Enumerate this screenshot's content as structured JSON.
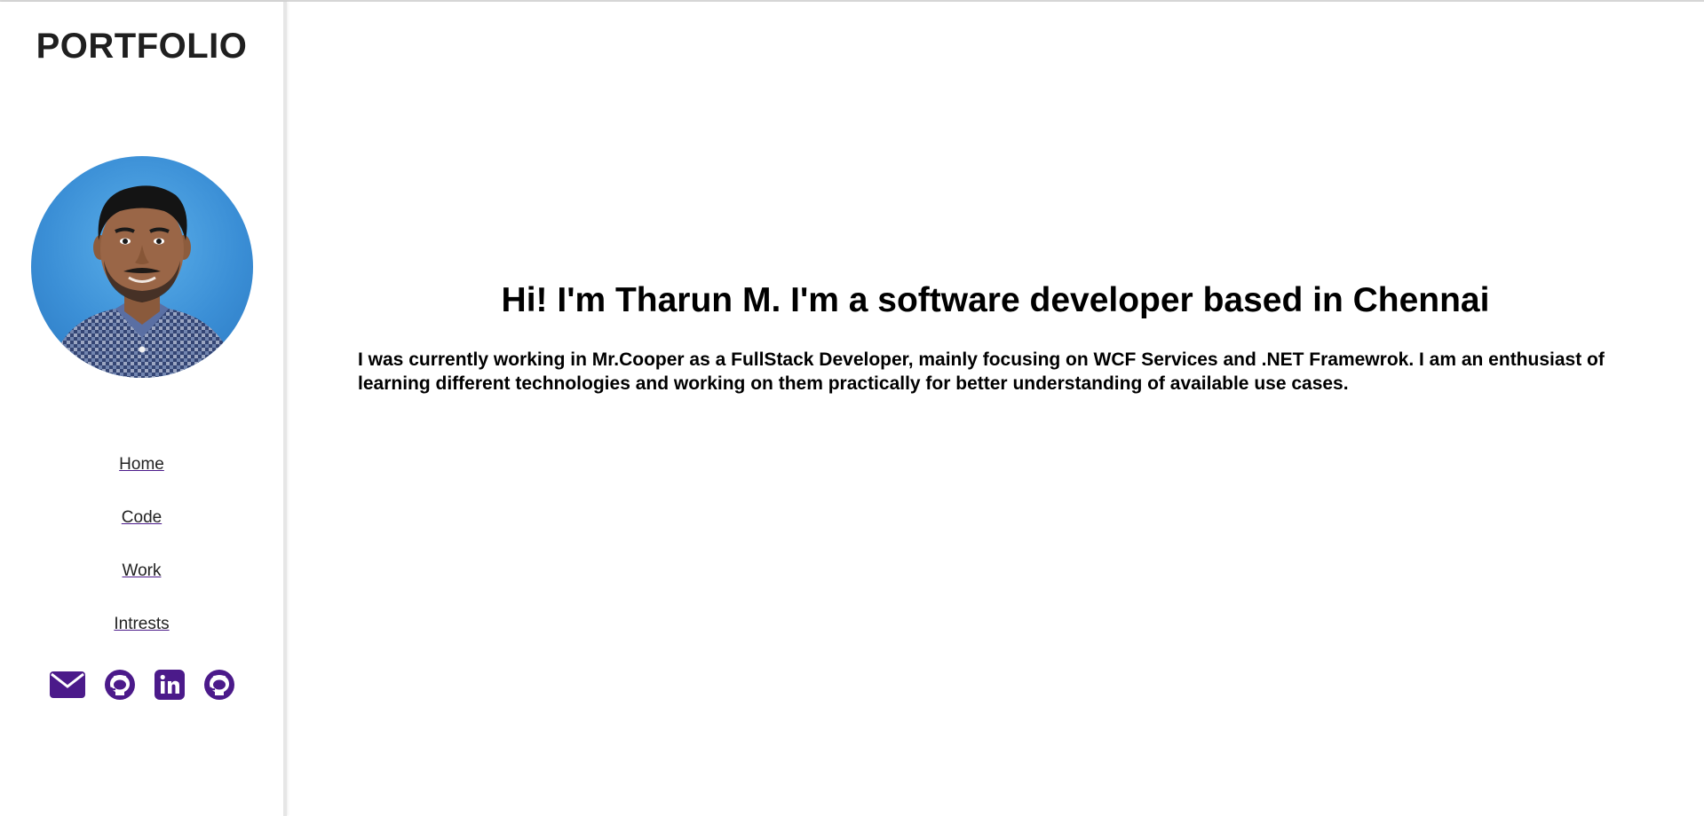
{
  "sidebar": {
    "brand": "PORTFOLIO",
    "nav": [
      {
        "label": "Home"
      },
      {
        "label": "Code"
      },
      {
        "label": "Work"
      },
      {
        "label": "Intrests"
      }
    ],
    "social_icons": [
      "email-icon",
      "github-icon",
      "linkedin-icon",
      "github-icon"
    ]
  },
  "main": {
    "headline": "Hi! I'm Tharun M. I'm a software developer based in Chennai",
    "intro": "I was currently working in Mr.Cooper as a FullStack Developer, mainly focusing on WCF Services and .NET Framewrok. I am an enthusiast of learning different technologies and working on them practically for better understanding of available use cases."
  },
  "colors": {
    "accent": "#4b1a8a",
    "avatar_background": "#3b8fd6",
    "sidebar_border": "#e6e6e6"
  }
}
